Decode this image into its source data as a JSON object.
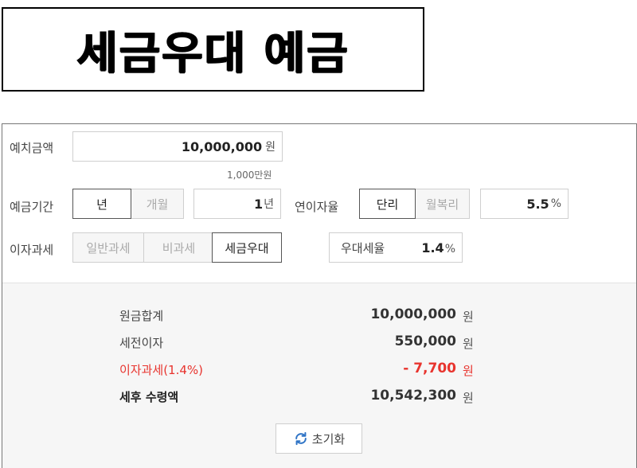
{
  "heading": {
    "title": "세금우대 예금"
  },
  "inputs": {
    "deposit": {
      "label": "예치금액",
      "value": "10,000,000",
      "unit": "원",
      "hint": "1,000만원"
    },
    "period": {
      "label": "예금기간",
      "options": [
        "년",
        "개월"
      ],
      "selected": "년",
      "value": "1",
      "unit": "년"
    },
    "rate": {
      "label": "연이자율",
      "options": [
        "단리",
        "월복리"
      ],
      "selected": "단리",
      "value": "5.5",
      "unit": "%"
    },
    "tax": {
      "label": "이자과세",
      "options": [
        "일반과세",
        "비과세",
        "세금우대"
      ],
      "selected": "세금우대",
      "preferential_label": "우대세율",
      "preferential_value": "1.4",
      "preferential_unit": "%"
    }
  },
  "results": {
    "principal": {
      "label": "원금합계",
      "value": "10,000,000",
      "unit": "원"
    },
    "pretax_interest": {
      "label": "세전이자",
      "value": "550,000",
      "unit": "원"
    },
    "interest_tax": {
      "label": "이자과세(1.4%)",
      "value": "- 7,700",
      "unit": "원"
    },
    "net_receipt": {
      "label": "세후 수령액",
      "value": "10,542,300",
      "unit": "원"
    }
  },
  "reset": {
    "label": "초기화",
    "icon": "refresh-icon"
  },
  "colors": {
    "accent_red": "#e8342e",
    "active_border": "#555555",
    "result_bg": "#f6f6f6"
  }
}
